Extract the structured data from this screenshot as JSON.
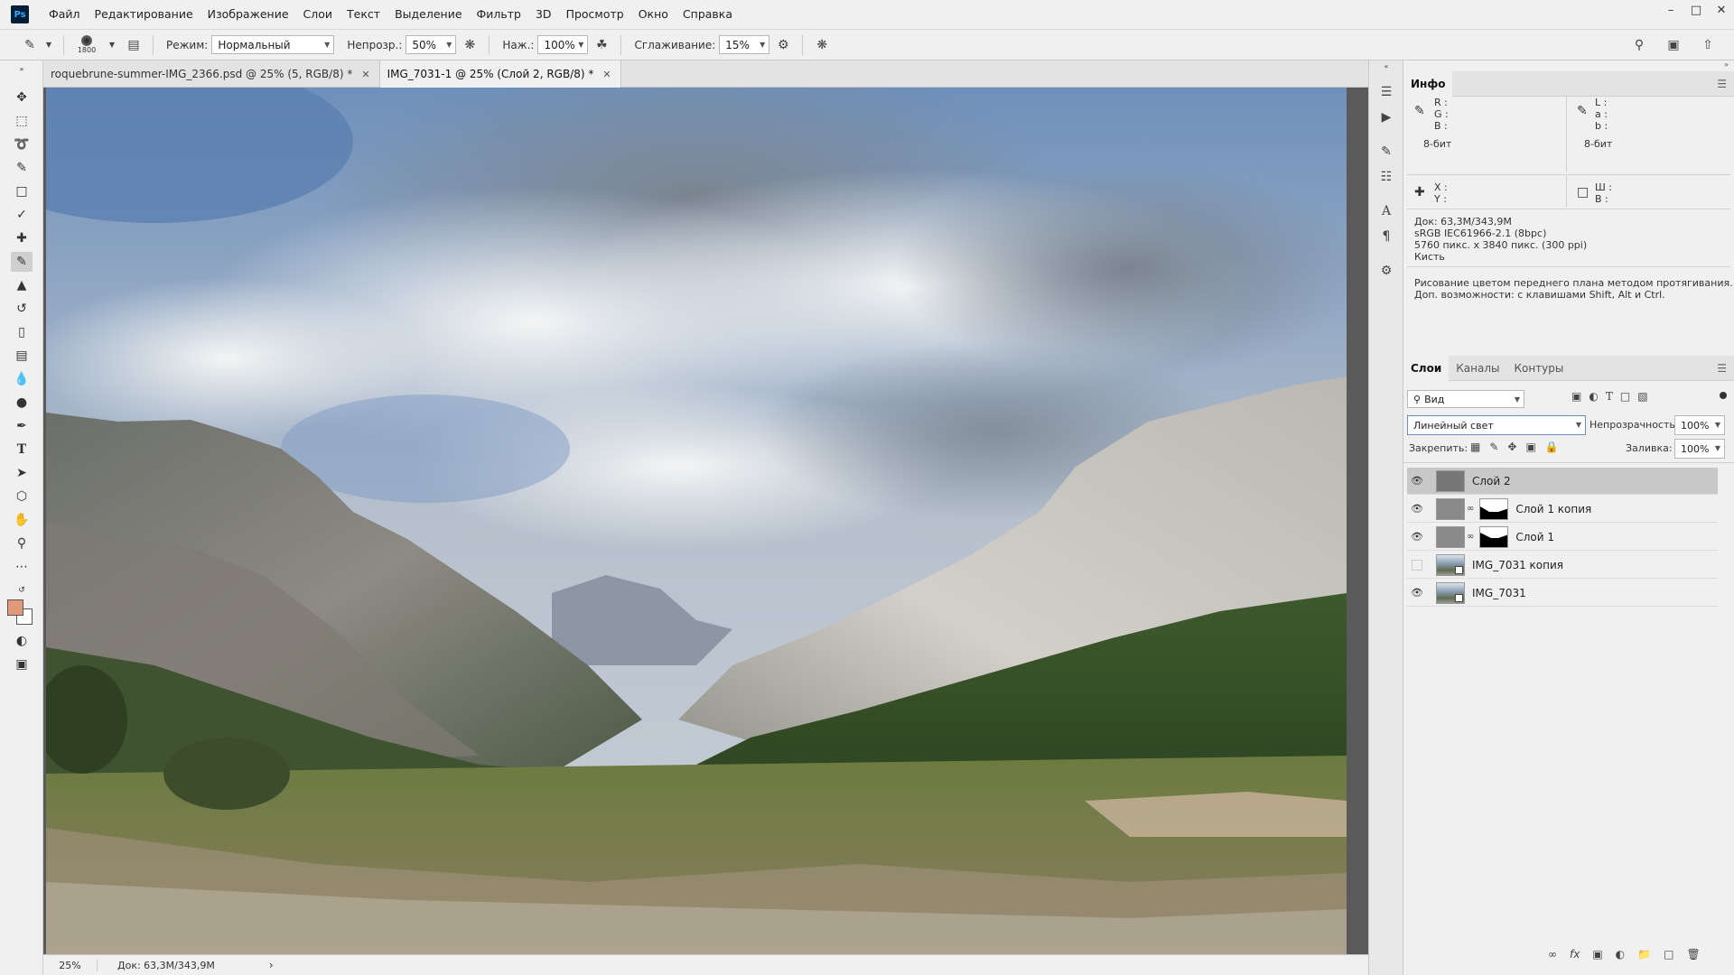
{
  "app": {
    "logo": "Ps"
  },
  "menu": [
    "Файл",
    "Редактирование",
    "Изображение",
    "Слои",
    "Текст",
    "Выделение",
    "Фильтр",
    "3D",
    "Просмотр",
    "Окно",
    "Справка"
  ],
  "options": {
    "brush_size": "1800",
    "mode_label": "Режим:",
    "mode_value": "Нормальный",
    "opacity_label": "Непрозр.:",
    "opacity_value": "50%",
    "pressure_label": "Наж.:",
    "pressure_value": "100%",
    "smoothing_label": "Сглаживание:",
    "smoothing_value": "15%"
  },
  "tabs": [
    {
      "label": "roquebrune-summer-IMG_2366.psd @ 25% (5, RGB/8) *",
      "active": false
    },
    {
      "label": "IMG_7031-1 @ 25% (Слой 2, RGB/8) *",
      "active": true
    }
  ],
  "status": {
    "zoom": "25%",
    "doc": "Док: 63,3M/343,9M",
    "arrow": "›"
  },
  "info": {
    "tab": "Инфо",
    "rgb": "R :\nG :\nB :",
    "lab": "L :\na :\nb :",
    "bit_left": "8-бит",
    "bit_right": "8-бит",
    "xy": "X :\nY :",
    "wh": "Ш :\nВ :",
    "doc": "Док: 63,3M/343,9M",
    "profile": "sRGB IEC61966-2.1 (8bpc)",
    "dims": "5760 пикс. x 3840 пикс. (300 ppi)",
    "tool": "Кисть",
    "hint1": "Рисование цветом переднего плана методом протягивания.",
    "hint2": "Доп. возможности: с клавишами Shift, Alt и Ctrl."
  },
  "layers_panel": {
    "tabs": [
      "Слои",
      "Каналы",
      "Контуры"
    ],
    "filter": "Вид",
    "blend_mode": "Линейный свет",
    "opacity_label": "Непрозрачность:",
    "opacity_value": "100%",
    "lock_label": "Закрепить:",
    "fill_label": "Заливка:",
    "fill_value": "100%",
    "layers": [
      {
        "name": "Слой 2",
        "visible": true,
        "selected": true
      },
      {
        "name": "Слой 1 копия",
        "visible": true,
        "selected": false
      },
      {
        "name": "Слой 1",
        "visible": true,
        "selected": false
      },
      {
        "name": "IMG_7031 копия",
        "visible": false,
        "selected": false
      },
      {
        "name": "IMG_7031",
        "visible": true,
        "selected": false
      }
    ]
  },
  "colors": {
    "foreground": "#e09a7a",
    "background": "#ffffff",
    "selected_row": "#c8c8c8"
  }
}
